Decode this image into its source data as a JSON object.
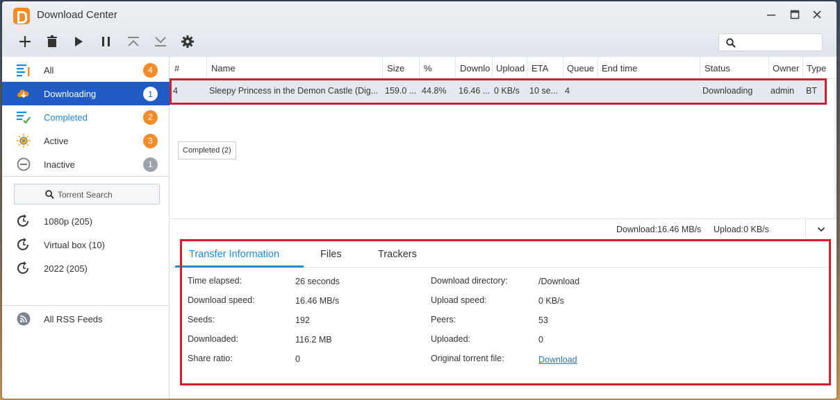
{
  "window": {
    "title": "Download Center",
    "accent": "#1f5cc7",
    "highlight_color": "#d0202e",
    "badge_orange": "#f28c28",
    "badge_gray": "#9ea4ab"
  },
  "toolbar": {
    "items": [
      "add-icon",
      "delete-icon",
      "play-icon",
      "pause-icon",
      "move-top-icon",
      "move-bottom-icon",
      "gear-icon"
    ],
    "search_placeholder": ""
  },
  "sidebar": {
    "items": [
      {
        "label": "All",
        "badge": "4",
        "icon": "list-all-icon"
      },
      {
        "label": "Downloading",
        "badge": "1",
        "icon": "cloud-download-icon"
      },
      {
        "label": "Completed",
        "badge": "2",
        "icon": "list-check-icon"
      },
      {
        "label": "Active",
        "badge": "3",
        "icon": "sun-icon"
      },
      {
        "label": "Inactive",
        "badge": "1",
        "icon": "minus-circle-icon"
      }
    ],
    "torrent_search_label": "Torrent Search",
    "searches": [
      {
        "label": "1080p (205)"
      },
      {
        "label": "Virtual box (10)"
      },
      {
        "label": "2022 (205)"
      }
    ],
    "rss_label": "All RSS Feeds"
  },
  "table": {
    "headers": [
      "#",
      "Name",
      "Size",
      "%",
      "Downlo",
      "Upload",
      "ETA",
      "Queue",
      "End time",
      "Status",
      "Owner",
      "Type"
    ],
    "rows": [
      {
        "num": "4",
        "name": "Sleepy Princess in the Demon Castle (Dig...",
        "size": "159.0 ...",
        "percent": "44.8%",
        "download": "16.46 ...",
        "upload": "0 KB/s",
        "eta": "10 se...",
        "queue": "4",
        "end_time": "",
        "status": "Downloading",
        "owner": "admin",
        "type": "BT"
      }
    ],
    "completed_tag": "Completed (2)"
  },
  "statusbar": {
    "download": "Download:16.46 MB/s",
    "upload": "Upload:0 KB/s"
  },
  "details": {
    "tabs": [
      "Transfer Information",
      "Files",
      "Trackers"
    ],
    "left": [
      {
        "label": "Time elapsed:",
        "value": "26 seconds"
      },
      {
        "label": "Download speed:",
        "value": "16.46 MB/s"
      },
      {
        "label": "Seeds:",
        "value": "192"
      },
      {
        "label": "Downloaded:",
        "value": "116.2 MB"
      },
      {
        "label": "Share ratio:",
        "value": "0"
      }
    ],
    "right": [
      {
        "label": "Download directory:",
        "value": "/Download"
      },
      {
        "label": "Upload speed:",
        "value": "0 KB/s"
      },
      {
        "label": "Peers:",
        "value": "53"
      },
      {
        "label": "Uploaded:",
        "value": "0"
      },
      {
        "label": "Original torrent file:",
        "value": "Download"
      }
    ]
  }
}
